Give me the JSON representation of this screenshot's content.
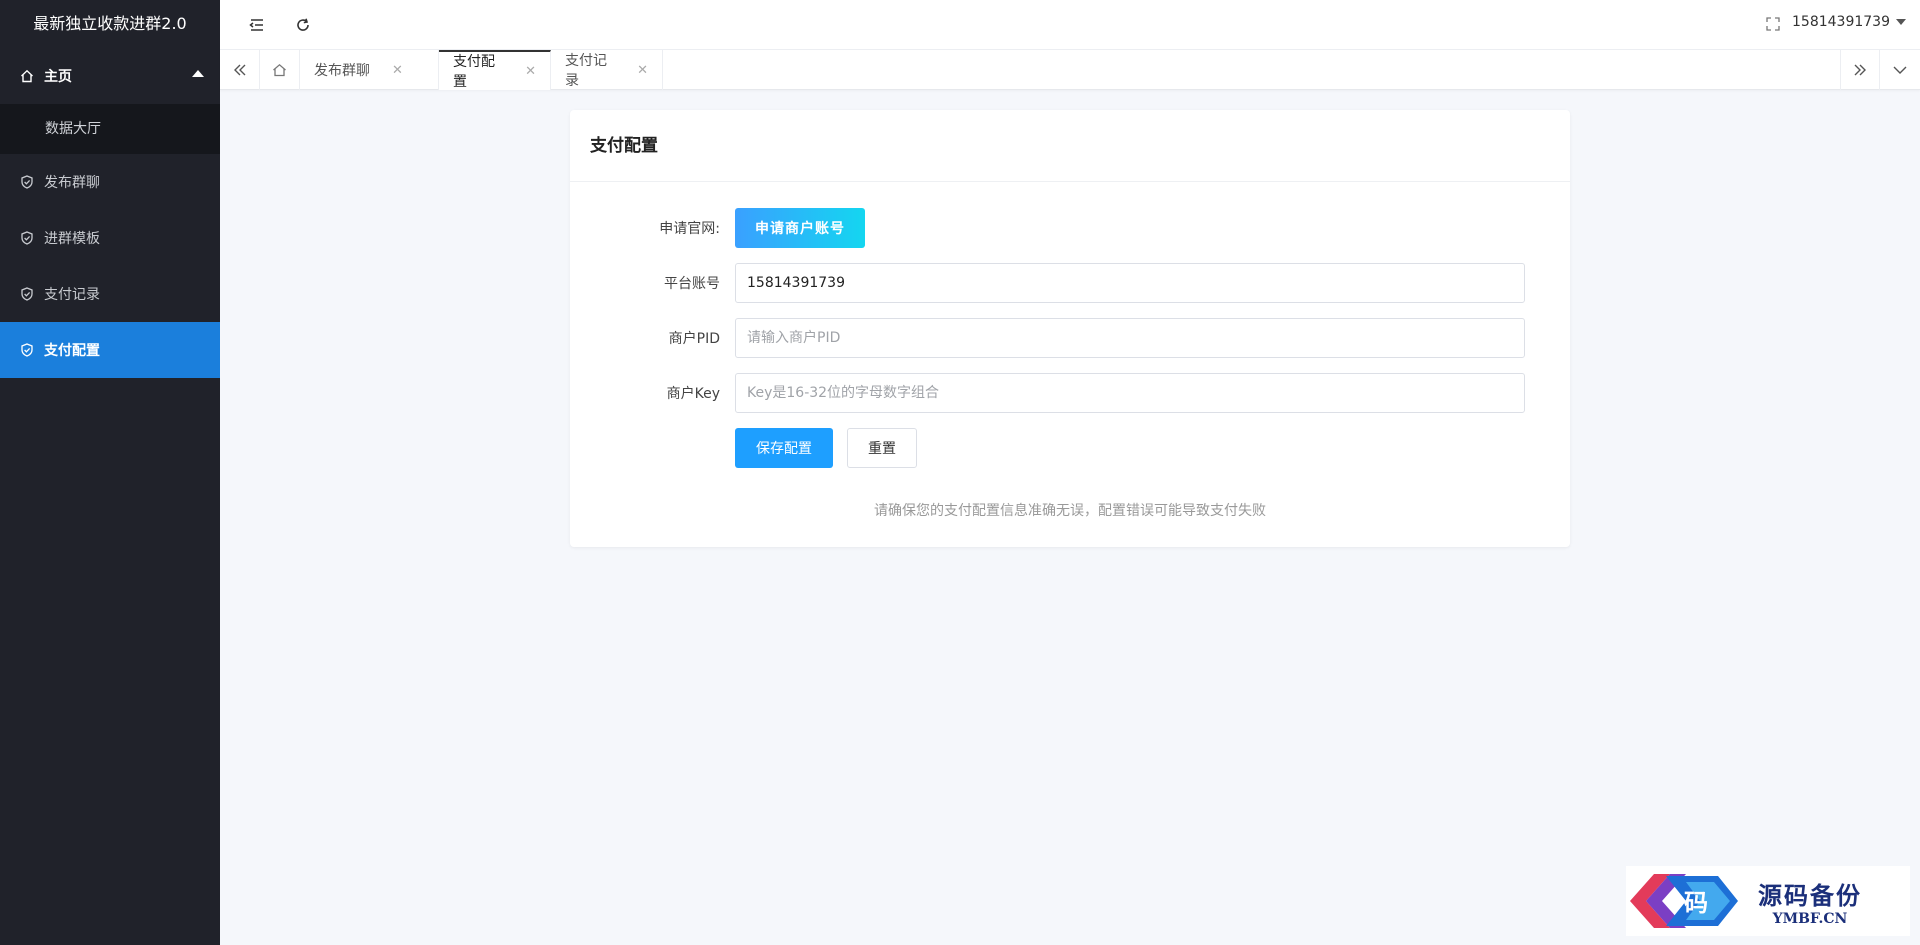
{
  "app": {
    "title": "最新独立收款进群2.0"
  },
  "sidebar": {
    "items": [
      {
        "label": "主页",
        "icon": "home-icon"
      },
      {
        "label": "数据大厅"
      },
      {
        "label": "发布群聊",
        "icon": "shield-check-icon"
      },
      {
        "label": "进群模板",
        "icon": "shield-check-icon"
      },
      {
        "label": "支付记录",
        "icon": "shield-check-icon"
      },
      {
        "label": "支付配置",
        "icon": "shield-check-icon",
        "active": true
      }
    ]
  },
  "header": {
    "user": "15814391739"
  },
  "tabs": [
    {
      "label": "发布群聊"
    },
    {
      "label": "支付配置",
      "active": true
    },
    {
      "label": "支付记录"
    }
  ],
  "form": {
    "title": "支付配置",
    "apply_label": "申请官网:",
    "apply_button": "申请商户账号",
    "account_label": "平台账号",
    "account_value": "15814391739",
    "pid_label": "商户PID",
    "pid_placeholder": "请输入商户PID",
    "key_label": "商户Key",
    "key_placeholder": "Key是16-32位的字母数字组合",
    "save_button": "保存配置",
    "reset_button": "重置",
    "tip": "请确保您的支付配置信息准确无误，配置错误可能导致支付失败"
  },
  "watermark": {
    "cn": "源码备份",
    "en": "YMBF.CN"
  },
  "colors": {
    "sidebar_bg": "#20222a",
    "active": "#1b7fdc",
    "primary": "#1e9fff"
  }
}
